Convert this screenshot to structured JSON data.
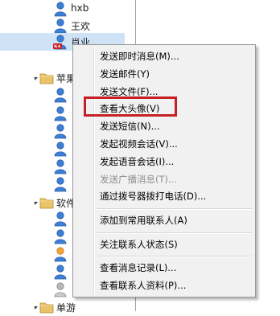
{
  "contacts": [
    {
      "name": "hxb",
      "status": "online"
    },
    {
      "name": "王欢",
      "status": "online"
    },
    {
      "name": "肖业",
      "status": "offline_na",
      "selected": true
    }
  ],
  "groups": [
    {
      "name": "苹果"
    },
    {
      "name": "软件"
    },
    {
      "name": "单游"
    }
  ],
  "context_menu": {
    "items": [
      {
        "label": "发送即时消息(M)...",
        "enabled": true
      },
      {
        "label": "发送邮件(Y)",
        "enabled": true
      },
      {
        "label": "发送文件(F)...",
        "enabled": true
      },
      {
        "label": "查看大头像(V)",
        "enabled": true,
        "highlighted": true
      },
      {
        "label": "发送短信(N)...",
        "enabled": true
      },
      {
        "label": "发起视频会话(V)...",
        "enabled": true
      },
      {
        "label": "发起语音会话(I)...",
        "enabled": true
      },
      {
        "label": "发送广播消息(T)...",
        "enabled": false
      },
      {
        "label": "通过拨号器拨打电话(D)...",
        "enabled": true
      },
      {
        "label": "添加到常用联系人(A)",
        "enabled": true
      },
      {
        "label": "关注联系人状态(S)",
        "enabled": true
      },
      {
        "label": "查看消息记录(L)...",
        "enabled": true
      },
      {
        "label": "查看联系人资料(P)...",
        "enabled": true
      }
    ]
  },
  "colors": {
    "highlight_box": "#c62025",
    "selection": "#cfe2f6",
    "user_online": "#2f6fc7",
    "user_away": "#e89a2b",
    "folder": "#d9b45a"
  }
}
